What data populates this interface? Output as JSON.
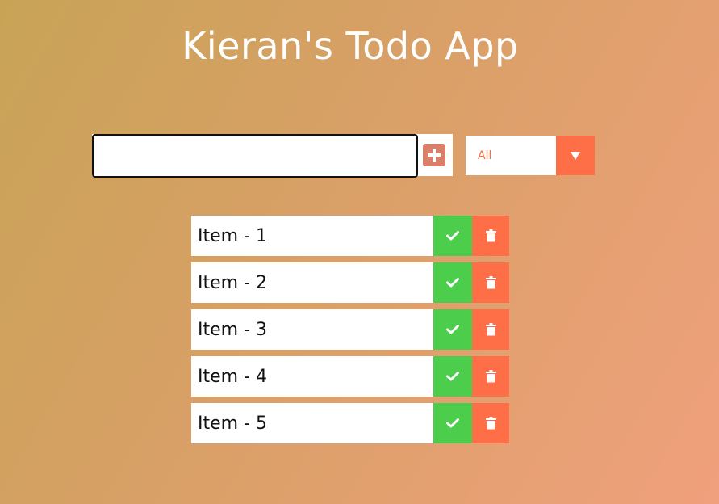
{
  "app": {
    "title": "Kieran's Todo App"
  },
  "form": {
    "input_value": "",
    "add_icon": "plus-icon"
  },
  "filter": {
    "selected": "All",
    "arrow_icon": "caret-down-icon"
  },
  "todos": [
    {
      "text": "Item - 1"
    },
    {
      "text": "Item - 2"
    },
    {
      "text": "Item - 3"
    },
    {
      "text": "Item - 4"
    },
    {
      "text": "Item - 5"
    }
  ],
  "colors": {
    "complete": "#4ccd4c",
    "delete": "#ff6f47",
    "add": "#d9806b"
  }
}
